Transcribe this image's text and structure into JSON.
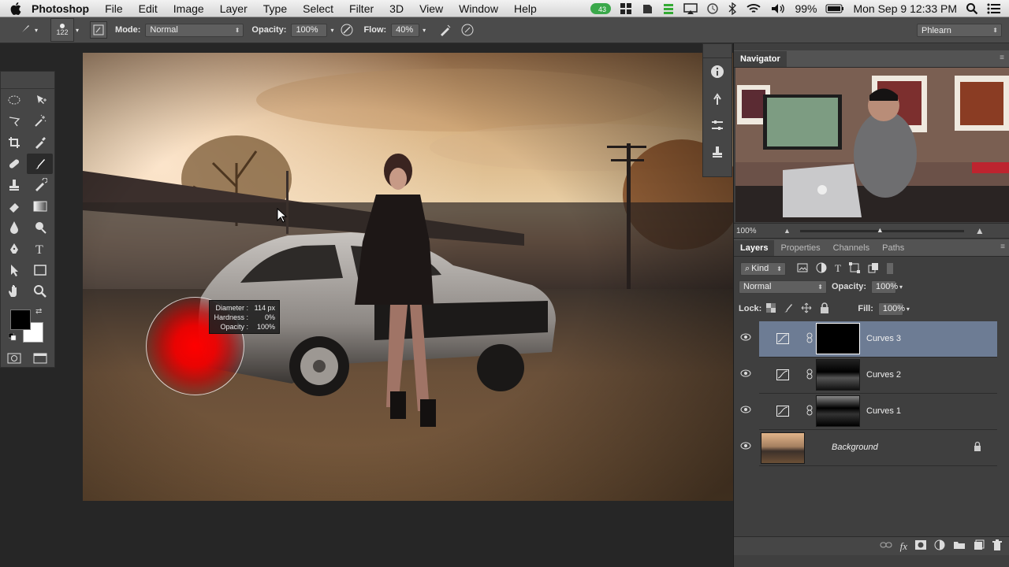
{
  "menubar": {
    "app_name": "Photoshop",
    "items": [
      "File",
      "Edit",
      "Image",
      "Layer",
      "Type",
      "Select",
      "Filter",
      "3D",
      "View",
      "Window",
      "Help"
    ],
    "battery": "99%",
    "datetime": "Mon Sep 9  12:33 PM",
    "badge": "43"
  },
  "options": {
    "brush_size": "122",
    "mode_label": "Mode:",
    "mode_value": "Normal",
    "opacity_label": "Opacity:",
    "opacity_value": "100%",
    "flow_label": "Flow:",
    "flow_value": "40%",
    "workspace": "Phlearn"
  },
  "hud": {
    "diameter_label": "Diameter :",
    "diameter_value": "114 px",
    "hardness_label": "Hardness :",
    "hardness_value": "0%",
    "opacity_label": "Opacity :",
    "opacity_value": "100%"
  },
  "navigator": {
    "tab": "Navigator",
    "zoom": "100%"
  },
  "layers_panel": {
    "tabs": [
      "Layers",
      "Properties",
      "Channels",
      "Paths"
    ],
    "filter_kind": "Kind",
    "blend_mode": "Normal",
    "opacity_label": "Opacity:",
    "opacity_value": "100%",
    "lock_label": "Lock:",
    "fill_label": "Fill:",
    "fill_value": "100%",
    "layers": [
      {
        "name": "Curves 3",
        "selected": true
      },
      {
        "name": "Curves 2",
        "selected": false
      },
      {
        "name": "Curves 1",
        "selected": false
      },
      {
        "name": "Background",
        "selected": false,
        "locked": true
      }
    ]
  },
  "colors": {
    "foreground": "#000000",
    "background": "#ffffff",
    "selection": "#6d7c94",
    "panel": "#3f3f3f"
  }
}
